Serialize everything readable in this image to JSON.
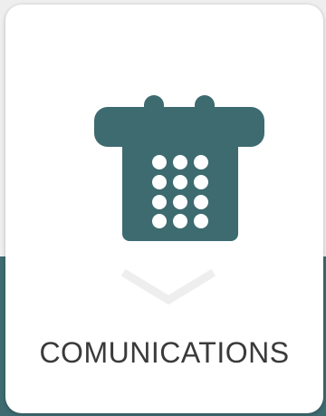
{
  "card": {
    "title": "COMUNICATIONS",
    "icon": "telephone-icon",
    "indicator_icon": "chevron-down-icon"
  },
  "colors": {
    "accent": "#3d6b70",
    "card_background": "#ffffff",
    "chevron": "#eeeeee",
    "title_text": "#3a3a3a"
  }
}
